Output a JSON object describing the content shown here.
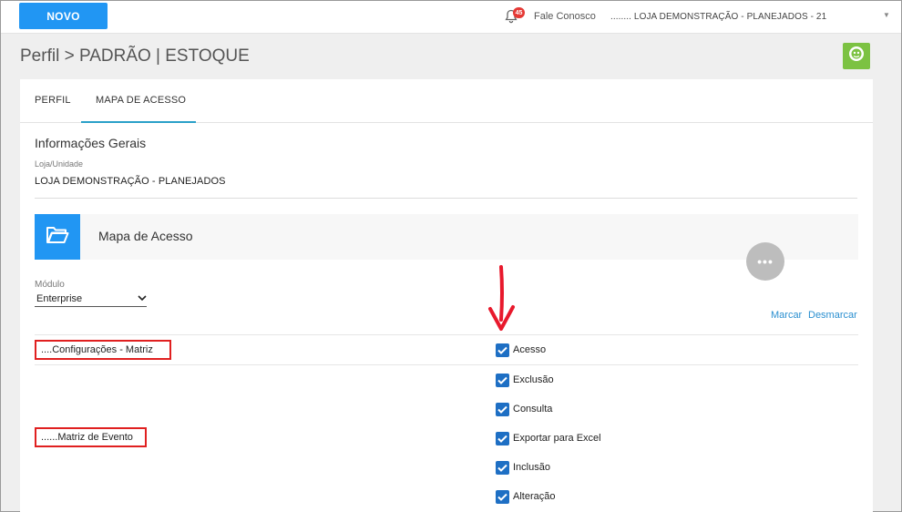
{
  "topbar": {
    "new_button": "NOVO",
    "notification_count": "45",
    "contact_link": "Fale Conosco",
    "store_selector": "........ LOJA DEMONSTRAÇÃO - PLANEJADOS - 21"
  },
  "page": {
    "title": "Perfil > PADRÃO | ESTOQUE"
  },
  "tabs": [
    {
      "label": "PERFIL"
    },
    {
      "label": "MAPA DE ACESSO",
      "active": true
    }
  ],
  "general": {
    "section_title": "Informações Gerais",
    "store_label": "Loja/Unidade",
    "store_value": "LOJA DEMONSTRAÇÃO - PLANEJADOS"
  },
  "access_map": {
    "title": "Mapa de Acesso",
    "more_button": "•••",
    "module_label": "Módulo",
    "module_selected": "Enterprise",
    "mark_link": "Marcar",
    "unmark_link": "Desmarcar"
  },
  "permission_groups": [
    {
      "label": "....Configurações - Matriz"
    },
    {
      "label": "......Matriz de Evento"
    }
  ],
  "permissions": [
    {
      "label": "Acesso",
      "checked": true
    },
    {
      "label": "Exclusão",
      "checked": true
    },
    {
      "label": "Consulta",
      "checked": true
    },
    {
      "label": "Exportar para Excel",
      "checked": true
    },
    {
      "label": "Inclusão",
      "checked": true
    },
    {
      "label": "Alteração",
      "checked": true
    }
  ],
  "colors": {
    "primary": "#2196f3",
    "help_button": "#7cc242",
    "highlight": "#e02020",
    "checkbox": "#1e6fc4"
  },
  "icons": {
    "bell": "bell-icon",
    "help": "chat-help-icon",
    "folder": "folder-open-icon",
    "annotation": "red-arrow-down-icon"
  }
}
